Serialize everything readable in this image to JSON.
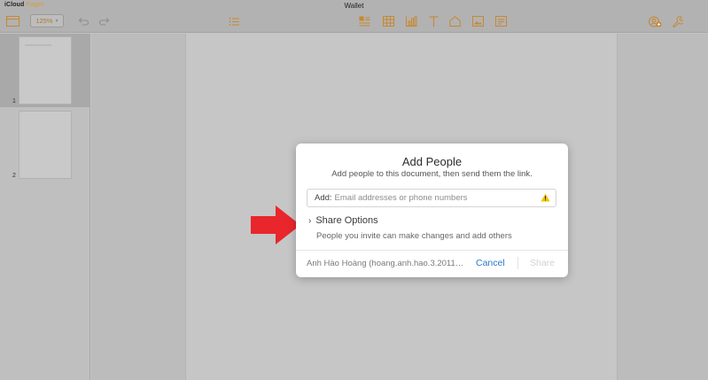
{
  "topbar": {
    "brand": "iCloud",
    "app_name": "Pages",
    "document_title": "Wallet",
    "zoom_value": "125%"
  },
  "sidebar": {
    "pages": [
      {
        "number": "1",
        "selected": true
      },
      {
        "number": "2",
        "selected": false
      }
    ]
  },
  "dialog": {
    "title": "Add People",
    "subtitle": "Add people to this document, then send them the link.",
    "add_label": "Add:",
    "add_placeholder": "Email addresses or phone numbers",
    "share_options_label": "Share Options",
    "share_options_desc": "People you invite can make changes and add others",
    "owner": "Anh Hào Hoàng (hoang.anh.hao.3.2011@...",
    "cancel_label": "Cancel",
    "share_label": "Share"
  },
  "colors": {
    "accent": "#d89a3a",
    "link": "#2b78c8",
    "arrow": "#e8262c",
    "warning": "#f3c200"
  }
}
